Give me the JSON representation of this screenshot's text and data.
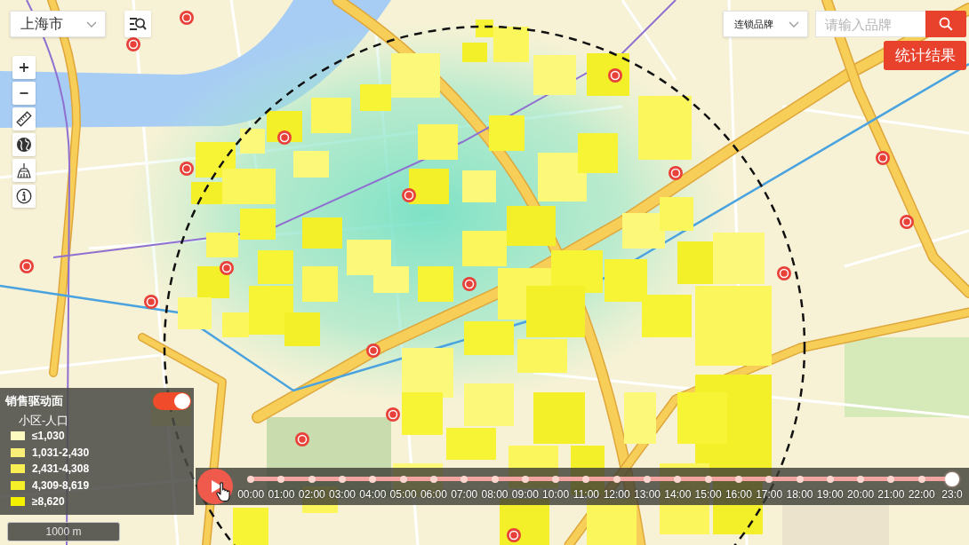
{
  "city_select": {
    "value": "上海市"
  },
  "map_tools": [
    {
      "kind": "zoom_in"
    },
    {
      "kind": "zoom_out"
    },
    {
      "kind": "measure"
    },
    {
      "kind": "globe"
    },
    {
      "kind": "clear"
    },
    {
      "kind": "info"
    }
  ],
  "brand_filter": {
    "select": {
      "value": "连锁品牌"
    },
    "search": {
      "placeholder": "请输入品牌"
    }
  },
  "stats_button": {
    "label": "统计结果"
  },
  "legend": {
    "title": "销售驱动面",
    "toggle": {
      "on": true
    },
    "layer": "小区-人口",
    "classes": [
      {
        "label": "≤1,030",
        "color": "#fdfac0"
      },
      {
        "label": "1,031-2,430",
        "color": "#f8ee78"
      },
      {
        "label": "2,431-4,308",
        "color": "#f9ef55"
      },
      {
        "label": "4,309-8,619",
        "color": "#f5ef2a"
      },
      {
        "label": "≥8,620",
        "color": "#f5f000"
      }
    ]
  },
  "timeline": {
    "level": 1,
    "ticks": [
      "00:00",
      "01:00",
      "02:00",
      "03:00",
      "04:00",
      "05:00",
      "06:00",
      "07:00",
      "08:00",
      "09:00",
      "10:00",
      "11:00",
      "12:00",
      "13:00",
      "14:00",
      "15:00",
      "16:00",
      "17:00",
      "18:00",
      "19:00",
      "20:00",
      "21:00",
      "22:00",
      "23:0"
    ]
  },
  "scale_bar": {
    "label": "1000 m"
  }
}
